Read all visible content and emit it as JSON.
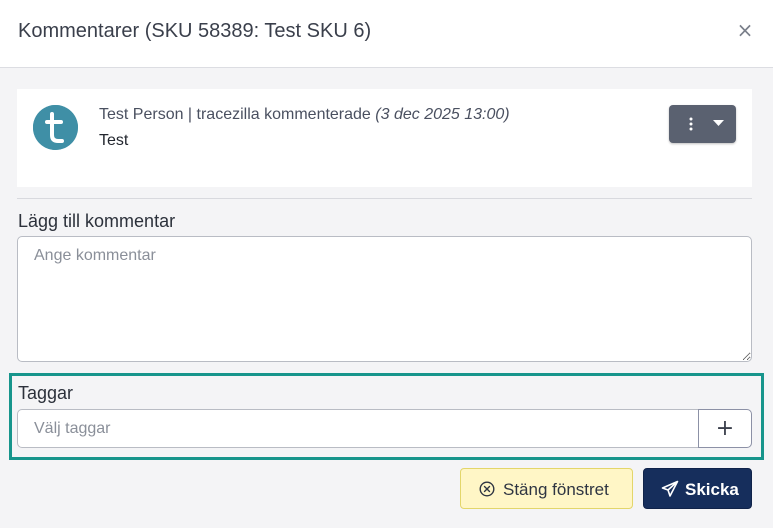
{
  "modal": {
    "title": "Kommentarer (SKU 58389: Test SKU 6)",
    "close_symbol": "×"
  },
  "comment": {
    "author": "Test Person | tracezilla kommenterade",
    "timestamp": "(3 dec 2025 13:00)",
    "body": "Test",
    "avatar_letter": "t",
    "avatar_icon": "avatar-letter-t",
    "actions_icon": "kebab-dropdown-icon"
  },
  "add_comment": {
    "label": "Lägg till kommentar",
    "placeholder": "Ange kommentar",
    "value": ""
  },
  "tags": {
    "label": "Taggar",
    "placeholder": "Välj taggar",
    "value": "",
    "add_symbol": "+"
  },
  "footer": {
    "close_label": "Stäng fönstret",
    "close_icon": "circle-x-icon",
    "send_label": "Skicka",
    "send_icon": "paper-plane-icon"
  },
  "colors": {
    "highlight_border": "#17958c",
    "send_button": "#162e5c",
    "close_button": "#fff6c6",
    "avatar": "#3f8fa6",
    "actions_button": "#5a6170"
  }
}
